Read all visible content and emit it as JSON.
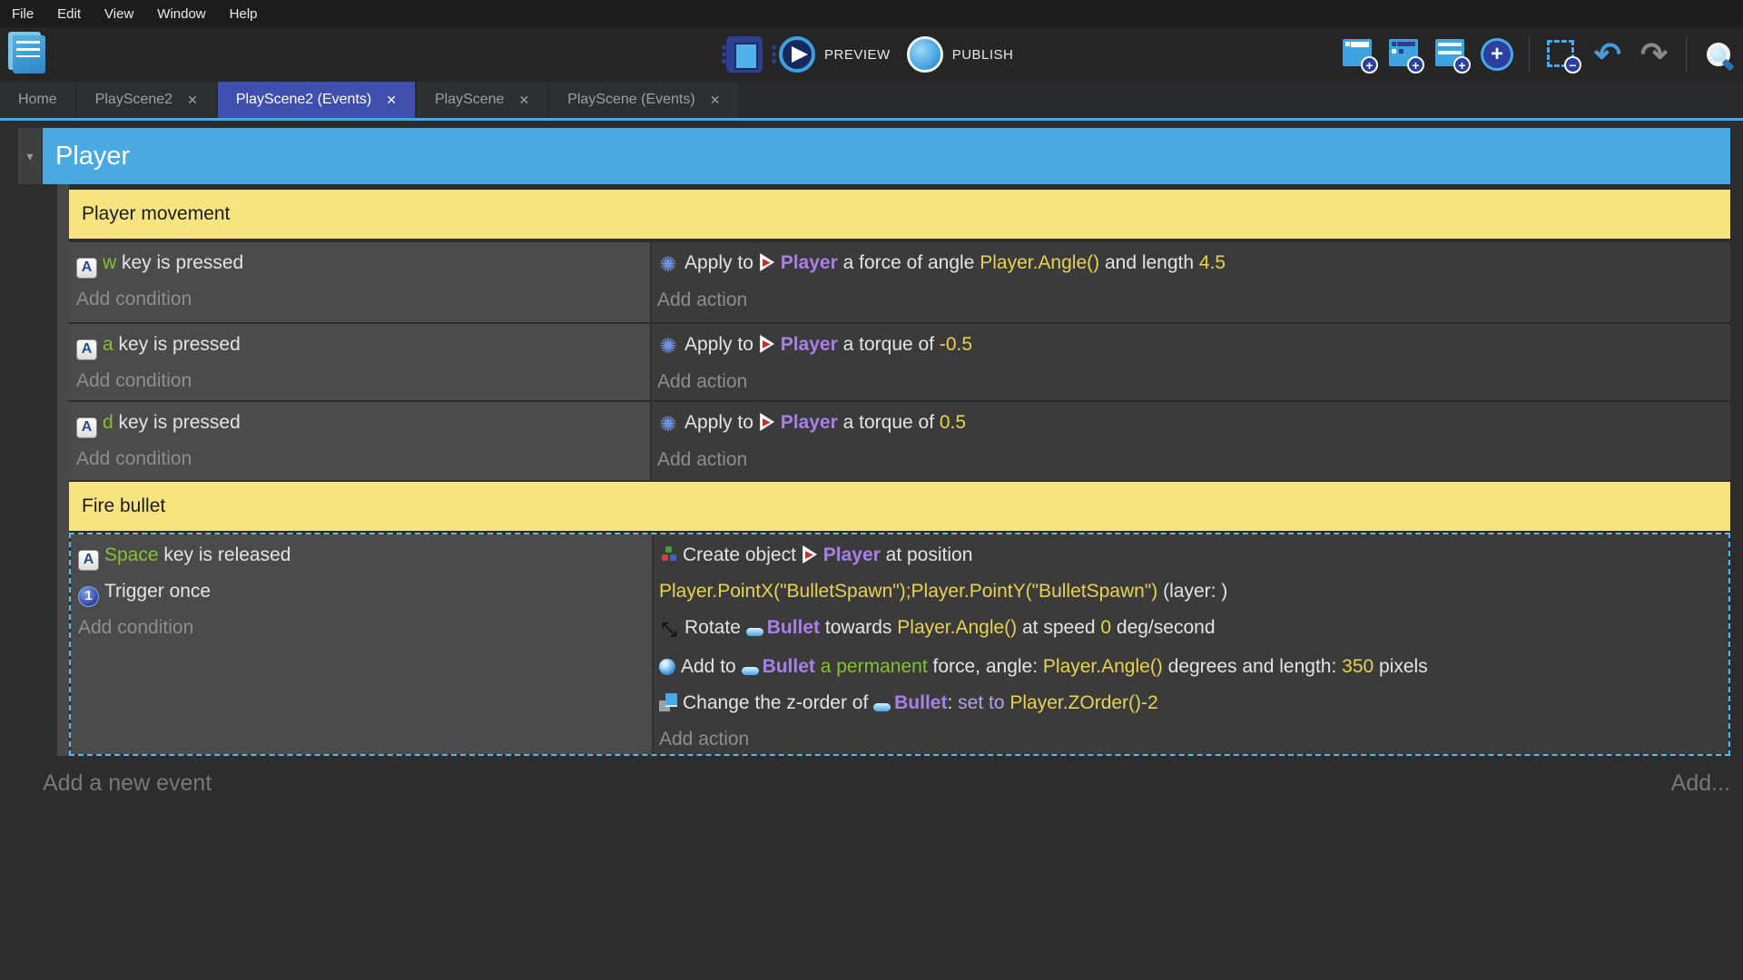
{
  "menu": {
    "items": [
      "File",
      "Edit",
      "View",
      "Window",
      "Help"
    ]
  },
  "toolbar": {
    "preview_label": "PREVIEW",
    "publish_label": "PUBLISH"
  },
  "icons": {
    "plus": "+",
    "minus": "−",
    "undo": "↶",
    "redo": "↷",
    "close": "✕",
    "chevron_down": "▾",
    "glyphs": {
      "keyboard-icon": "A",
      "trigger-once-icon": "1",
      "physics-icon": "✺",
      "rotate-icon": "⤡"
    }
  },
  "colors": {
    "group_bar": "#4aa9e1",
    "comment": "#f7e480",
    "active_tab": "#3e4fae",
    "selection_dash": "#5db7ea",
    "key": "#85c32b",
    "object": "#a97fe8",
    "expression": "#e8d34e",
    "operator": "#b9a0ee"
  },
  "tabs": [
    {
      "label": "Home",
      "active": false
    },
    {
      "label": "PlayScene2",
      "active": false
    },
    {
      "label": "PlayScene2 (Events)",
      "active": true
    },
    {
      "label": "PlayScene",
      "active": false
    },
    {
      "label": "PlayScene (Events)",
      "active": false
    }
  ],
  "sheet": {
    "group_title": "Player",
    "comment1": "Player movement",
    "comment2": "Fire bullet",
    "add_condition": "Add condition",
    "add_action": "Add action",
    "add_new_event": "Add a new event",
    "add_button": "Add...",
    "events": [
      {
        "conditions": [
          [
            {
              "icon": "keyboard-icon"
            },
            {
              "t": "w",
              "c": "key"
            },
            {
              "t": " key is pressed",
              "c": "plain"
            }
          ]
        ],
        "actions": [
          [
            {
              "icon": "physics-icon"
            },
            {
              "t": "Apply to ",
              "c": "plain"
            },
            {
              "icon": "player-object-icon"
            },
            {
              "t": "Player",
              "c": "object"
            },
            {
              "t": " a force of angle ",
              "c": "plain"
            },
            {
              "t": "Player.Angle()",
              "c": "expr"
            },
            {
              "t": " and length ",
              "c": "plain"
            },
            {
              "t": "4.5",
              "c": "expr"
            }
          ]
        ]
      },
      {
        "conditions": [
          [
            {
              "icon": "keyboard-icon"
            },
            {
              "t": "a",
              "c": "key"
            },
            {
              "t": " key is pressed",
              "c": "plain"
            }
          ]
        ],
        "actions": [
          [
            {
              "icon": "physics-icon"
            },
            {
              "t": "Apply to ",
              "c": "plain"
            },
            {
              "icon": "player-object-icon"
            },
            {
              "t": "Player",
              "c": "object"
            },
            {
              "t": " a torque of ",
              "c": "plain"
            },
            {
              "t": "-0.5",
              "c": "expr"
            }
          ]
        ]
      },
      {
        "conditions": [
          [
            {
              "icon": "keyboard-icon"
            },
            {
              "t": "d",
              "c": "key"
            },
            {
              "t": " key is pressed",
              "c": "plain"
            }
          ]
        ],
        "actions": [
          [
            {
              "icon": "physics-icon"
            },
            {
              "t": "Apply to ",
              "c": "plain"
            },
            {
              "icon": "player-object-icon"
            },
            {
              "t": "Player",
              "c": "object"
            },
            {
              "t": " a torque of ",
              "c": "plain"
            },
            {
              "t": "0.5",
              "c": "expr"
            }
          ]
        ]
      },
      {
        "selected": true,
        "conditions": [
          [
            {
              "icon": "keyboard-icon"
            },
            {
              "t": "Space",
              "c": "key"
            },
            {
              "t": " key is released",
              "c": "plain"
            }
          ],
          [
            {
              "icon": "trigger-once-icon"
            },
            {
              "t": "Trigger once",
              "c": "plain"
            }
          ]
        ],
        "actions": [
          [
            {
              "icon": "create-object-icon"
            },
            {
              "t": "Create object ",
              "c": "plain"
            },
            {
              "icon": "player-object-icon"
            },
            {
              "t": "Player",
              "c": "object"
            },
            {
              "t": " at position",
              "c": "plain"
            }
          ],
          [
            {
              "t": "Player.PointX(\"BulletSpawn\");Player.PointY(\"BulletSpawn\")",
              "c": "expr"
            },
            {
              "t": " (layer: )",
              "c": "plain"
            }
          ],
          [
            {
              "icon": "rotate-icon"
            },
            {
              "t": "Rotate ",
              "c": "plain"
            },
            {
              "icon": "bullet-object-icon"
            },
            {
              "t": "Bullet",
              "c": "object"
            },
            {
              "t": " towards ",
              "c": "plain"
            },
            {
              "t": "Player.Angle()",
              "c": "expr"
            },
            {
              "t": " at speed ",
              "c": "plain"
            },
            {
              "t": "0",
              "c": "expr"
            },
            {
              "t": " deg/second",
              "c": "plain"
            }
          ],
          [
            {
              "icon": "add-force-icon"
            },
            {
              "t": "Add to ",
              "c": "plain"
            },
            {
              "icon": "bullet-object-icon"
            },
            {
              "t": "Bullet",
              "c": "object"
            },
            {
              "t": " a permanent",
              "c": "green"
            },
            {
              "t": " force, angle: ",
              "c": "plain"
            },
            {
              "t": "Player.Angle()",
              "c": "expr"
            },
            {
              "t": " degrees and length: ",
              "c": "plain"
            },
            {
              "t": "350",
              "c": "expr"
            },
            {
              "t": " pixels",
              "c": "plain"
            }
          ],
          [
            {
              "icon": "zorder-icon"
            },
            {
              "t": "Change the z-order of ",
              "c": "plain"
            },
            {
              "icon": "bullet-object-icon"
            },
            {
              "t": "Bullet",
              "c": "object"
            },
            {
              "t": ": ",
              "c": "plain"
            },
            {
              "t": "set to ",
              "c": "op"
            },
            {
              "t": "Player.ZOrder()-2",
              "c": "expr"
            }
          ]
        ]
      }
    ]
  }
}
